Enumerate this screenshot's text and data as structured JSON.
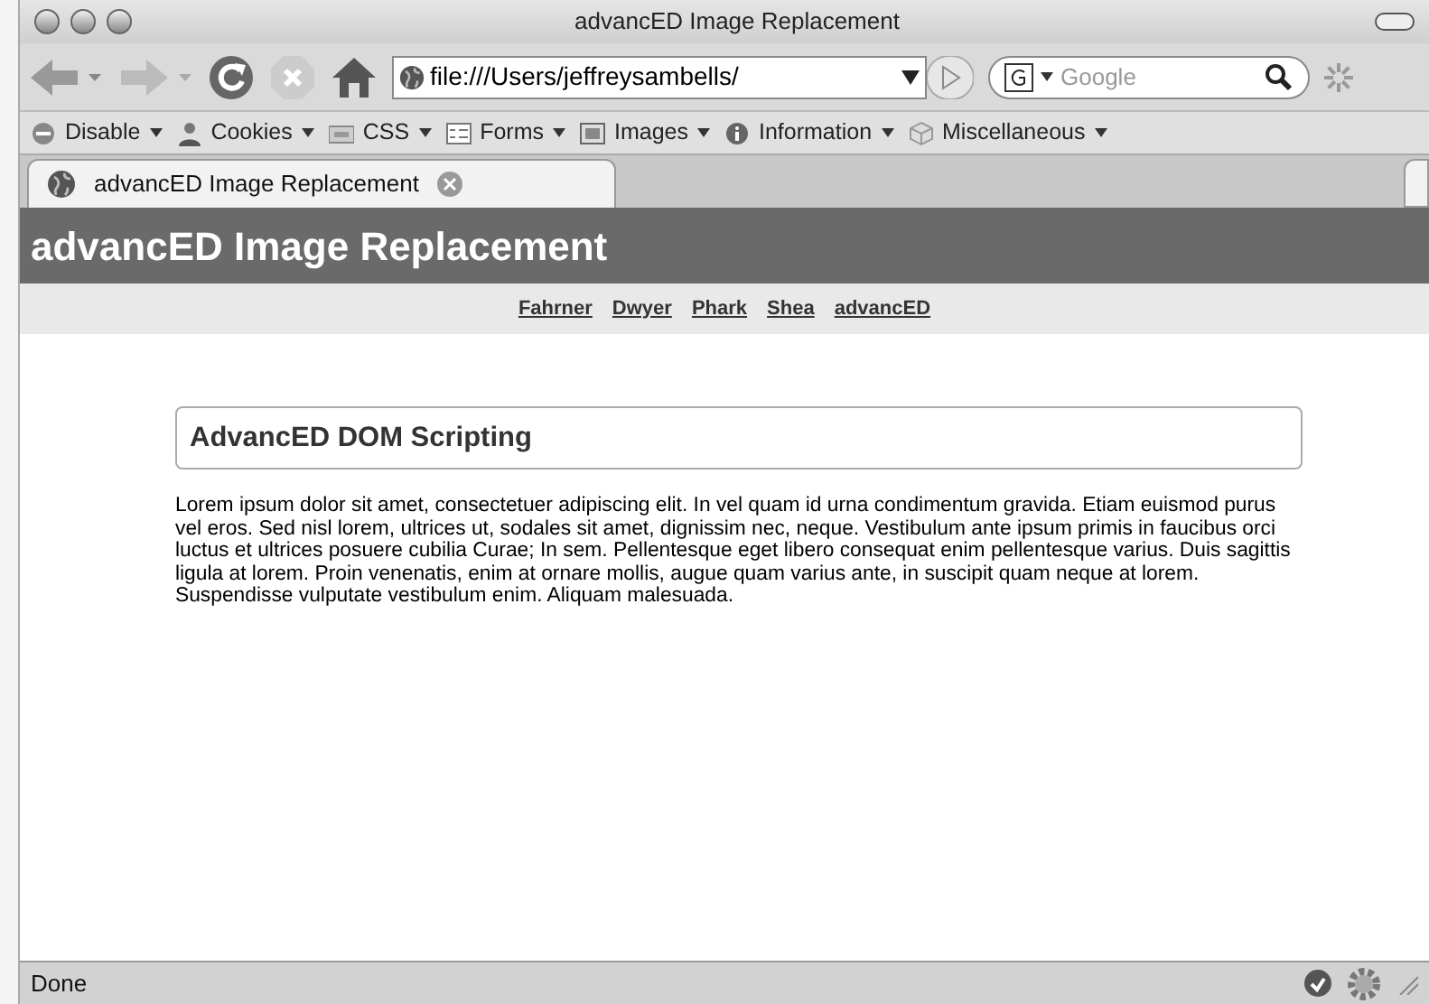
{
  "window": {
    "title": "advancED Image Replacement"
  },
  "address": {
    "value": "file:///Users/jeffreysambells/"
  },
  "search": {
    "placeholder": "Google"
  },
  "dev_toolbar": [
    {
      "label": "Disable"
    },
    {
      "label": "Cookies"
    },
    {
      "label": "CSS"
    },
    {
      "label": "Forms"
    },
    {
      "label": "Images"
    },
    {
      "label": "Information"
    },
    {
      "label": "Miscellaneous"
    }
  ],
  "tabs": [
    {
      "label": "advancED Image Replacement",
      "selected": true
    }
  ],
  "page": {
    "header": "advancED Image Replacement",
    "nav_links": [
      "Fahrner",
      "Dwyer",
      "Phark",
      "Shea",
      "advancED"
    ],
    "heading": "AdvancED DOM Scripting",
    "paragraph": "Lorem ipsum dolor sit amet, consectetuer adipiscing elit. In vel quam id urna condimentum gravida. Etiam euismod purus vel eros. Sed nisl lorem, ultrices ut, sodales sit amet, dignissim nec, neque. Vestibulum ante ipsum primis in faucibus orci luctus et ultrices posuere cubilia Curae; In sem. Pellentesque eget libero consequat enim pellentesque varius. Duis sagittis ligula at lorem. Proin venenatis, enim at ornare mollis, augue quam varius ante, in suscipit quam neque at lorem. Suspendisse vulputate vestibulum enim. Aliquam malesuada."
  },
  "status_bar": {
    "text": "Done"
  }
}
